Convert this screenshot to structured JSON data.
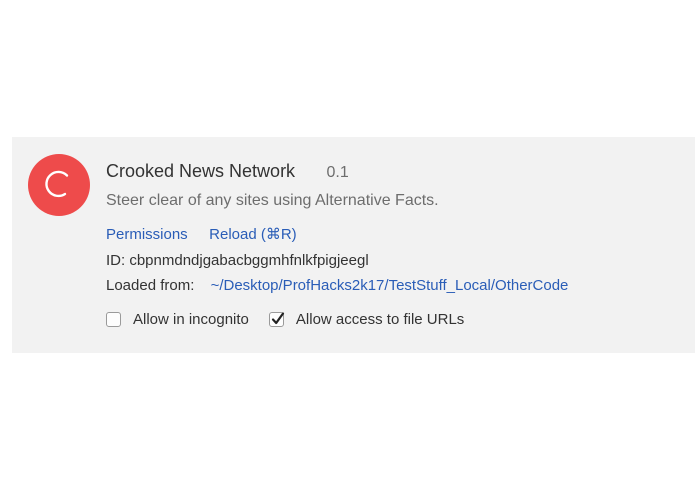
{
  "extension": {
    "name": "Crooked News Network",
    "version": "0.1",
    "description": "Steer clear of any sites using Alternative Facts.",
    "icon": "crooked-news-logo-icon",
    "icon_color": "#ee4b4b",
    "links": {
      "permissions": "Permissions",
      "reload": "Reload (⌘R)"
    },
    "id_text": "ID: cbpnmdndjgabacbggmhfnlkfpigjeegl",
    "loaded_from_label": "Loaded from:",
    "loaded_from_path": "~/Desktop/ProfHacks2k17/TestStuff_Local/OtherCode",
    "options": {
      "incognito": {
        "label": "Allow in incognito",
        "checked": false
      },
      "file_urls": {
        "label": "Allow access to file URLs",
        "checked": true
      }
    }
  },
  "colors": {
    "card_background": "#f2f2f2",
    "link": "#2a5db7",
    "text_primary": "#333333",
    "text_secondary": "#6d6d6d"
  }
}
